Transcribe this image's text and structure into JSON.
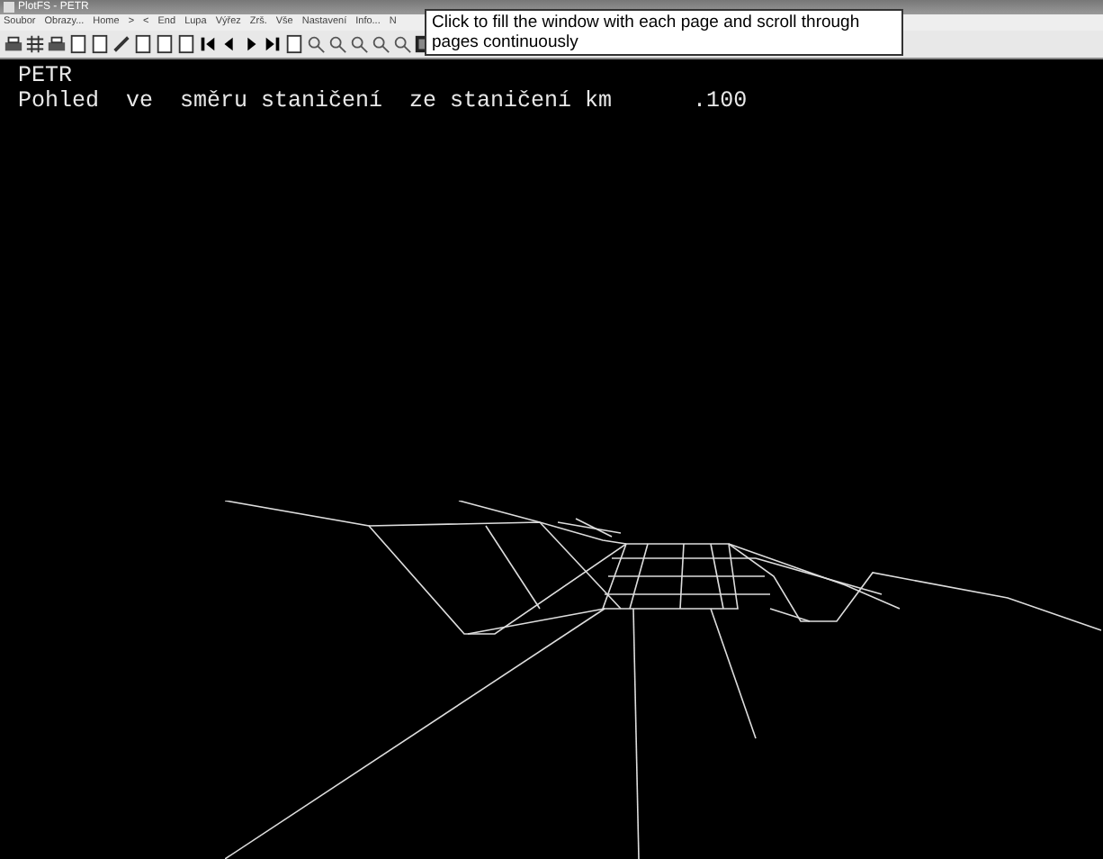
{
  "window": {
    "title": "PlotFS - PETR"
  },
  "menu": [
    "Soubor",
    "Obrazy...",
    "Home",
    ">",
    "<",
    "End",
    "Lupa",
    "Výřez",
    "Zrš.",
    "Vše",
    "Nastavení",
    "Info...",
    "N"
  ],
  "tooltip": {
    "text": "Click to fill the window with each page and scroll through pages continuously"
  },
  "canvas": {
    "lines": [
      "PETR",
      "Pohled  ve  směru staničení  ze staničení km      .100"
    ]
  }
}
